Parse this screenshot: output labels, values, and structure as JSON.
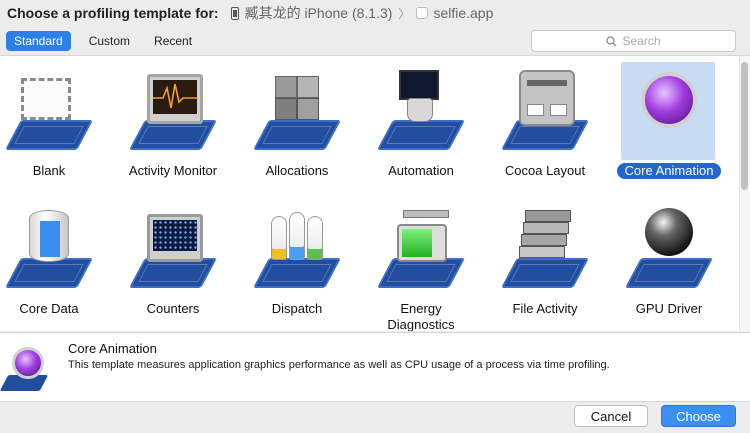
{
  "header": {
    "title": "Choose a profiling template for:",
    "device": "臧其龙的 iPhone (8.1.3)",
    "separator": "〉",
    "app": "selfie.app"
  },
  "tabs": [
    "Standard",
    "Custom",
    "Recent"
  ],
  "active_tab": "Standard",
  "search": {
    "placeholder": "Search"
  },
  "templates": [
    {
      "label": "Blank",
      "icon": "blank-icon"
    },
    {
      "label": "Activity Monitor",
      "icon": "activity-monitor-icon"
    },
    {
      "label": "Allocations",
      "icon": "allocations-icon"
    },
    {
      "label": "Automation",
      "icon": "automation-icon"
    },
    {
      "label": "Cocoa Layout",
      "icon": "cocoa-layout-icon"
    },
    {
      "label": "Core Animation",
      "icon": "core-animation-icon",
      "selected": true
    },
    {
      "label": "Core Data",
      "icon": "core-data-icon"
    },
    {
      "label": "Counters",
      "icon": "counters-icon"
    },
    {
      "label": "Dispatch",
      "icon": "dispatch-icon"
    },
    {
      "label": "Energy Diagnostics",
      "icon": "energy-diagnostics-icon"
    },
    {
      "label": "File Activity",
      "icon": "file-activity-icon"
    },
    {
      "label": "GPU Driver",
      "icon": "gpu-driver-icon"
    }
  ],
  "detail": {
    "title": "Core Animation",
    "description": "This template measures application graphics performance as well as CPU usage of a process via time profiling."
  },
  "buttons": {
    "cancel": "Cancel",
    "choose": "Choose"
  },
  "colors": {
    "accent": "#2e80e6",
    "selection": "#2166d2",
    "selection_bg": "#c9dcf5",
    "base_blue": "#234d9e"
  }
}
